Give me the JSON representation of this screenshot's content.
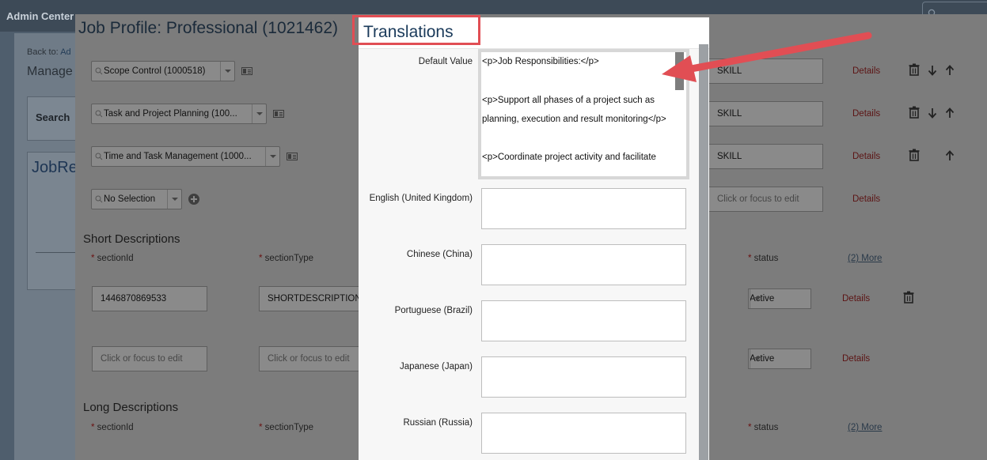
{
  "colors": {
    "annotation": "#e14e54",
    "details_link": "#5c1414",
    "translations_title": "#1a3a5a"
  },
  "top_bar": {
    "title": "Admin Center"
  },
  "background_page": {
    "back_to_label": "Back to:",
    "back_to_link": "Ad",
    "manage_label": "Manage",
    "search_label": "Search",
    "job_req_label": "JobRe"
  },
  "job_profile_dialog": {
    "title": "Job Profile: Professional (1021462)",
    "skill_rows": [
      {
        "combo_value": "Scope Control (1000518)",
        "type_value": "SKILL",
        "details_label": "Details"
      },
      {
        "combo_value": "Task and Project Planning (100...",
        "type_value": "SKILL",
        "details_label": "Details"
      },
      {
        "combo_value": "Time and Task Management (1000...",
        "type_value": "SKILL",
        "details_label": "Details"
      },
      {
        "combo_value": "No Selection",
        "type_placeholder": "Click or focus to edit",
        "details_label": "Details"
      }
    ],
    "short_descriptions": {
      "heading": "Short Descriptions",
      "col_section_id": "sectionId",
      "col_section_type": "sectionType",
      "col_status": "status",
      "more_link": "(2) More",
      "rows": [
        {
          "section_id": "1446870869533",
          "section_type": "SHORTDESCRIPTION",
          "status": "Active",
          "details_label": "Details"
        },
        {
          "section_id_placeholder": "Click or focus to edit",
          "section_type_placeholder": "Click or focus to edit",
          "status": "Active",
          "details_label": "Details"
        }
      ]
    },
    "long_descriptions": {
      "heading": "Long Descriptions",
      "col_section_id": "sectionId",
      "col_section_type": "sectionType",
      "col_status": "status",
      "more_link": "(2) More"
    }
  },
  "translations_dialog": {
    "title": "Translations",
    "default_value_label": "Default Value",
    "default_value_lines": [
      "<p>Job Responsibilities:</p>",
      "<p>Support all phases of a project such as",
      "planning, execution and result monitoring</p>",
      "<p>Coordinate project activity and facilitate"
    ],
    "languages": [
      {
        "label": "English (United Kingdom)",
        "value": ""
      },
      {
        "label": "Chinese (China)",
        "value": ""
      },
      {
        "label": "Portuguese (Brazil)",
        "value": ""
      },
      {
        "label": "Japanese (Japan)",
        "value": ""
      },
      {
        "label": "Russian (Russia)",
        "value": ""
      }
    ]
  }
}
